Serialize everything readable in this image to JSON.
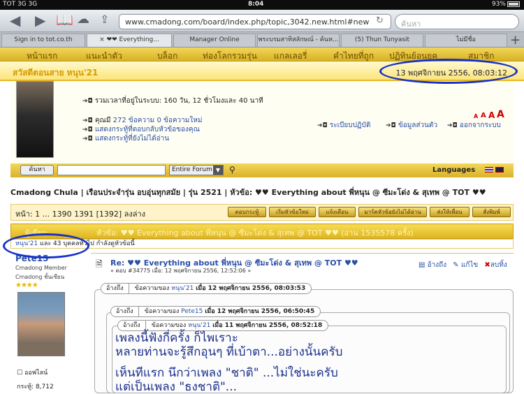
{
  "status_bar": {
    "carrier": "TOT 3G  3G",
    "time": "8:04",
    "battery": "93%"
  },
  "browser": {
    "url": "www.cmadong.com/board/index.php/topic,3042.new.html#new",
    "search_placeholder": "ค้นหา",
    "tabs": [
      {
        "label": "Sign in to tot.co.th"
      },
      {
        "label": "× ❤❤ Everything..."
      },
      {
        "label": "Manager Online"
      },
      {
        "label": "พระบรมสาทิสลักษณ์ - ค้นห..."
      },
      {
        "label": "(5) Thun Tunyasit"
      },
      {
        "label": "ไม่มีชื่อ"
      }
    ]
  },
  "site_nav": [
    "หน้าแรก",
    "แนะนำตัว",
    "บล็อก",
    "ท่องโลกรวมรุ่น",
    "แกลเลอรี่",
    "คำไทยที่ถูก",
    "ปฏิทินย้อนยุค",
    "สมาชิก"
  ],
  "greeting": {
    "text": "สวัสดีตอนสาย หนุน'21",
    "datetime": "13 พฤศจิกายน 2556, 08:03:12"
  },
  "profile": {
    "online_time": "รวมเวลาที่อยู่ในระบบ: 160 วัน, 12 ชั่วโมงและ 40 นาที",
    "messages_prefix": "คุณมี",
    "messages_count": "272",
    "messages_mid": "ข้อความ",
    "messages_new": "0",
    "messages_suffix": "ข้อความใหม่",
    "show_replies": "แสดงกระทู้ที่ตอบกลับหัวข้อของคุณ",
    "show_unread": "แสดงกระทู้ที่ยังไม่ได้อ่าน",
    "rules": "ระเบียบปฏิบัติ",
    "my_profile": "ข้อมูลส่วนตัว",
    "logout": "ออกจากระบบ",
    "font_sizes": [
      "A",
      "A",
      "A",
      "A"
    ]
  },
  "search": {
    "button": "ค้นหา",
    "scope": "Entire Forum",
    "languages": "Languages"
  },
  "breadcrumb": "Cmadong Chula  |  เรือนประจำรุ่น อบอุ่นทุกสมัย  |  รุ่น 2521  |  หัวข้อ: ♥♥ Everything about พี่หนุน @ ซีมะโด่ง & สุเทพ @ TOT ♥♥",
  "pager": {
    "text": "หน้า: 1 ... 1390 1391 [1392]  ลงล่าง",
    "buttons": [
      "ตอบกระทู้",
      "เริ่มหัวข้อใหม่",
      "แจ้งเตือน",
      "มาร์คหัวข้อยังไม่ได้อ่าน",
      "ส่งให้เพื่อน",
      "สั่งพิมพ์"
    ]
  },
  "topic": {
    "author_label": "ผู้เขียน",
    "title": "หัวข้อ: ♥♥ Everything about พี่หนุน @ ซีมะโด่ง & สุเทพ @ TOT ♥♥  (อ่าน 1535578 ครั้ง)",
    "viewers_user": "หนุน'21",
    "viewers_text": " และ 43 บุคคลทั่วไป กำลังดูหัวข้อนี้"
  },
  "post": {
    "author": "Pete15",
    "rank1": "Cmadong Member",
    "rank2": "Cmadong ชั้นเซียน",
    "stars": "★★★★",
    "offline": "ออฟไลน์",
    "post_count": "กระทู้: 8,712",
    "title": "Re: ♥♥ Everything about พี่หนุน @ ซีมะโด่ง & สุเทพ @ TOT ♥♥",
    "subtitle": "« ตอบ #34775 เมื่อ: 12 พฤศจิกายน 2556, 12:52:06 »",
    "actions": [
      "อ้างถึง",
      "แก้ไข",
      "ลบทิ้ง"
    ],
    "quote_tab": "อ้างถึง",
    "quote1": {
      "prefix": "ข้อความของ",
      "user": "หนุน'21",
      "suffix": "เมื่อ 12 พฤศจิกายน 2556, 08:03:53"
    },
    "quote2": {
      "prefix": "ข้อความของ",
      "user": "Pete15",
      "suffix": "เมื่อ 12 พฤศจิกายน 2556, 06:50:45"
    },
    "quote3": {
      "prefix": "ข้อความของ",
      "user": "หนุน'21",
      "suffix": "เมื่อ 11 พฤศจิกายน 2556, 08:52:18"
    },
    "body_lines": [
      "เพลงนี้ฟังกี่ครั้ง ก็ไพเราะ",
      "หลายท่านจะรู้สึกอุนๆ ที่เบ้าตา...อย่างนั้นครับ",
      "เห็นทีแรก นึกว่าเพลง \"ชาติ\" ...ไม่ใช่นะครับ",
      "แต่เป็นเพลง \"ธงชาติ\"..."
    ]
  },
  "colors": {
    "nav_gold": "#d9b22a",
    "link_blue": "#2a4fa6",
    "annotation_ring": "#1732c8",
    "body_text": "#1b2f8c"
  }
}
